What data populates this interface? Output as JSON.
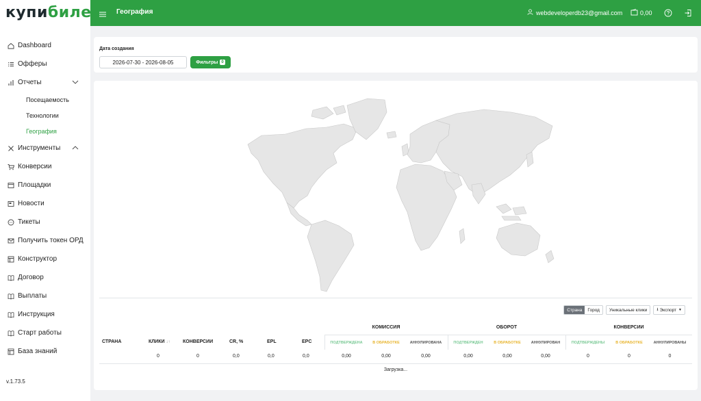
{
  "logo": {
    "part1": "купи",
    "part2": "билет"
  },
  "nav": {
    "items": [
      {
        "label": "Dashboard",
        "icon": "home-icon"
      },
      {
        "label": "Офферы",
        "icon": "list-icon"
      },
      {
        "label": "Отчеты",
        "icon": "bar-chart-icon"
      }
    ],
    "sub_items": [
      {
        "label": "Посещаемость"
      },
      {
        "label": "Технологии"
      },
      {
        "label": "География"
      }
    ],
    "items2": [
      {
        "label": "Инструменты",
        "icon": "tools-icon"
      },
      {
        "label": "Конверсии",
        "icon": "cart-icon"
      },
      {
        "label": "Площадки",
        "icon": "window-icon"
      },
      {
        "label": "Новости",
        "icon": "newspaper-icon"
      },
      {
        "label": "Тикеты",
        "icon": "chat-icon"
      },
      {
        "label": "Получить токен ОРД",
        "icon": "mail-icon"
      },
      {
        "label": "Конструктор",
        "icon": "layout-icon"
      },
      {
        "label": "Договор",
        "icon": "book-icon"
      },
      {
        "label": "Выплаты",
        "icon": "book-icon"
      },
      {
        "label": "Инструкция",
        "icon": "book-icon"
      },
      {
        "label": "Старт работы",
        "icon": "book-icon"
      },
      {
        "label": "База знаний",
        "icon": "layout-icon"
      }
    ],
    "version": "v.1.73.5"
  },
  "header": {
    "title": "География",
    "email": "webdeveloperdb23@gmail.com",
    "balance": "0,00"
  },
  "filters": {
    "date_label": "Дата создания",
    "date_value": "2026-07-30 - 2026-08-05",
    "filter_button": "Фильтры",
    "filter_count": "0"
  },
  "table": {
    "controls": {
      "country": "Страна",
      "city": "Город",
      "unique": "Уникальные клики",
      "export": "Экспорт"
    },
    "headers": {
      "country": "СТРАНА",
      "clicks": "КЛИКИ",
      "conversions": "КОНВЕРСИИ",
      "cr": "CR, %",
      "epl": "EPL",
      "epc": "EPC"
    },
    "groups": {
      "commission": "КОМИССИЯ",
      "turnover": "ОБОРОТ",
      "conversions": "КОНВЕРСИИ"
    },
    "subs": {
      "commission": [
        "ПОДТВЕРЖДЕНА",
        "В ОБРАБОТКЕ",
        "АННУЛИРОВАНА"
      ],
      "turnover": [
        "ПОДТВЕРЖДЕН",
        "В ОБРАБОТКЕ",
        "АННУЛИРОВАН"
      ],
      "conversions": [
        "ПОДТВЕРЖДЕНЫ",
        "В ОБРАБОТКЕ",
        "АННУЛИРОВАНЫ"
      ]
    },
    "totals": {
      "clicks": "0",
      "conversions": "0",
      "cr": "0,0",
      "epl": "0,0",
      "epc": "0,0",
      "commission": [
        "0,00",
        "0,00",
        "0,00"
      ],
      "turnover": [
        "0,00",
        "0,00",
        "0,00"
      ],
      "conv": [
        "0",
        "0",
        "0"
      ]
    },
    "loading": "Загрузка..."
  },
  "colors": {
    "brand": "#2ea043",
    "map_fill": "#e6e6e6",
    "map_stroke": "#c8c8c8"
  }
}
